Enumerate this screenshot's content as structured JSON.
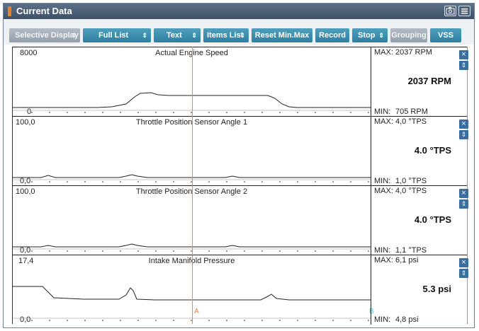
{
  "window": {
    "title": "Current Data"
  },
  "toolbar": {
    "selective_display": "Selective Display",
    "full_list": "Full List",
    "text": "Text",
    "items_list": "Items List",
    "reset": "Reset Min.Max",
    "record": "Record",
    "stop": "Stop",
    "grouping": "Grouping",
    "vss": "VSS"
  },
  "cursor": {
    "a": "A",
    "b": "B"
  },
  "panels": [
    {
      "title": "Actual Engine Speed",
      "ymax": "8000",
      "ymin": "0",
      "max_label": "MAX:",
      "max": "2037 RPM",
      "min_label": "MIN:",
      "min": "705 RPM",
      "value": "2037 RPM"
    },
    {
      "title": "Throttle Position Sensor Angle 1",
      "ymax": "100,0",
      "ymin": "0,0",
      "max_label": "MAX:",
      "max": "4,0 °TPS",
      "min_label": "MIN:",
      "min": "1,0 °TPS",
      "value": "4.0 °TPS"
    },
    {
      "title": "Throttle Position Sensor Angle 2",
      "ymax": "100,0",
      "ymin": "0,0",
      "max_label": "MAX:",
      "max": "4,0 °TPS",
      "min_label": "MIN:",
      "min": "1,1 °TPS",
      "value": "4.0 °TPS"
    },
    {
      "title": "Intake Manifold Pressure",
      "ymax": "17,4",
      "ymin": "0,0",
      "max_label": "MAX:",
      "max": "6,1 psi",
      "min_label": "MIN:",
      "min": "4,8 psi",
      "value": "5.3 psi"
    }
  ],
  "colors": {
    "titlebar": "#4a5d75",
    "button": "#2e86a8",
    "cursor": "#e48a45",
    "cursor_b": "#6fb3d9"
  }
}
